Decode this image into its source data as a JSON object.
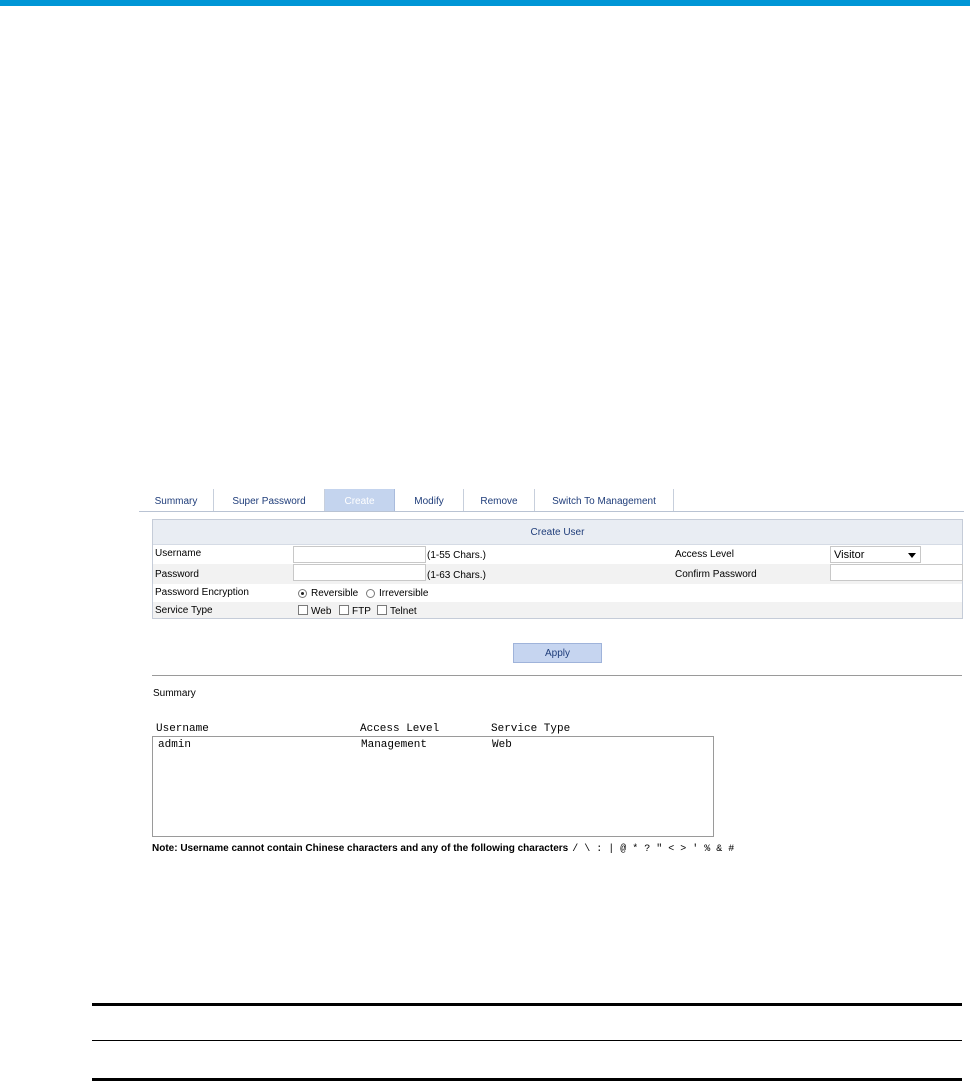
{
  "tabs": [
    "Summary",
    "Super Password",
    "Create",
    "Modify",
    "Remove",
    "Switch To Management"
  ],
  "active_tab": "Create",
  "panel": {
    "title": "Create User",
    "username_label": "Username",
    "username_value": "",
    "username_hint": "(1-55 Chars.)",
    "password_label": "Password",
    "password_value": "",
    "password_hint": "(1-63 Chars.)",
    "access_level_label": "Access Level",
    "access_level_value": "Visitor",
    "confirm_password_label": "Confirm Password",
    "encryption_label": "Password Encryption",
    "encryption_options": [
      "Reversible",
      "Irreversible"
    ],
    "encryption_selected": "Reversible",
    "service_type_label": "Service Type",
    "service_options": [
      "Web",
      "FTP",
      "Telnet"
    ]
  },
  "apply_label": "Apply",
  "summary": {
    "title": "Summary",
    "columns": [
      "Username",
      "Access Level",
      "Service Type"
    ],
    "rows": [
      [
        "admin",
        "Management",
        "Web"
      ]
    ]
  },
  "note": {
    "text": "Note: Username cannot contain Chinese characters and any of the following characters",
    "chars": "/ \\ : | @ * ? \" < > ' % & #"
  },
  "colors": {
    "top_bar": "#0096d6",
    "active_tab": "#c4d4ee",
    "link_text": "#1f3d7a"
  }
}
